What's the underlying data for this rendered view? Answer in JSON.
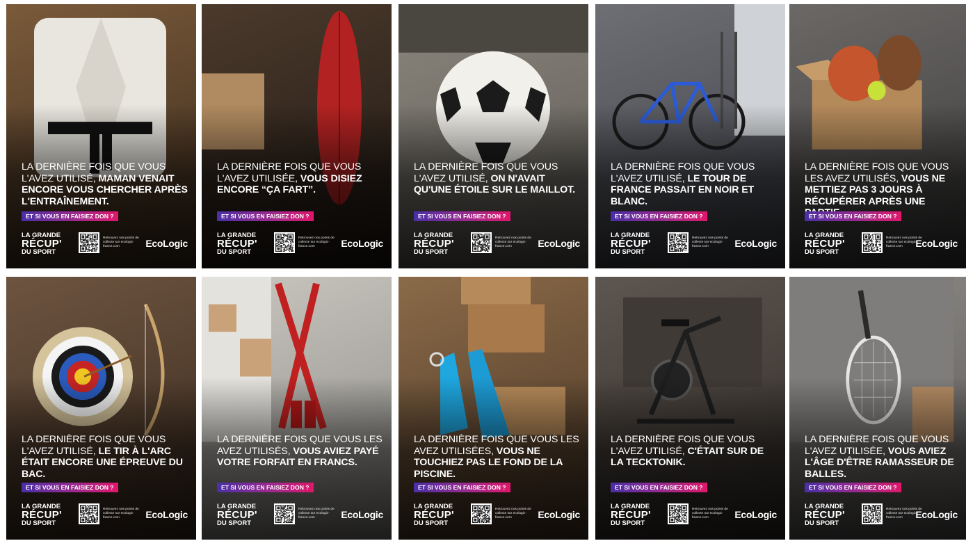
{
  "campaign": {
    "cta": "ET SI VOUS EN FAISIEZ DON ?",
    "brand_line1": "LA GRANDE",
    "brand_line2": "RÉCUP'",
    "brand_line3": "DU SPORT",
    "qr_text": "Retrouvez nos points de collecte sur ecologic-france.com",
    "logo": "EcoLogic",
    "cta_gradient": [
      "#4a2fa6",
      "#9b2a8e",
      "#e0176b"
    ]
  },
  "posters": [
    {
      "subject": "judo-gi-icon",
      "light": "LA DERNIÈRE FOIS QUE VOUS L'AVEZ UTILISÉ, ",
      "bold": "MAMAN VENAIT ENCORE VOUS CHERCHER APRÈS L'ENTRAÎNEMENT.",
      "bg": [
        "#3a2a1c",
        "#7a5a3a"
      ]
    },
    {
      "subject": "surfboard-icon",
      "light": "LA DERNIÈRE FOIS QUE VOUS L'AVEZ UTILISÉE, ",
      "bold": "VOUS DISIEZ ENCORE “ÇA FART”.",
      "bg": [
        "#1f1712",
        "#4b3a2c"
      ]
    },
    {
      "subject": "soccer-ball-icon",
      "light": "LA DERNIÈRE FOIS QUE VOUS L'AVEZ UTILISÉ, ",
      "bold": "ON N'AVAIT QU'UNE ÉTOILE SUR LE MAILLOT.",
      "bg": [
        "#5d5a55",
        "#8a857c"
      ]
    },
    {
      "subject": "bicycle-icon",
      "light": "LA DERNIÈRE FOIS QUE VOUS L'AVEZ UTILISÉ, ",
      "bold": "LE TOUR DE FRANCE PASSAIT EN NOIR ET BLANC.",
      "bg": [
        "#3d3f47",
        "#6e6f74"
      ]
    },
    {
      "subject": "balls-box-icon",
      "light": "LA DERNIÈRE FOIS QUE VOUS LES AVEZ UTILISÉS, ",
      "bold": "VOUS NE METTIEZ PAS 3 JOURS À RÉCUPÉRER APRÈS UNE PARTIE.",
      "bg": [
        "#3c3b3a",
        "#6b6866"
      ]
    },
    {
      "subject": "archery-target-icon",
      "light": "LA DERNIÈRE FOIS QUE VOUS L'AVEZ UTILISÉ, ",
      "bold": "LE TIR À L'ARC ÉTAIT ENCORE UNE ÉPREUVE DU BAC.",
      "bg": [
        "#3a2a1e",
        "#6d5440"
      ]
    },
    {
      "subject": "skis-icon",
      "light": "LA DERNIÈRE FOIS QUE VOUS LES AVEZ UTILISÉS, ",
      "bold": "VOUS AVIEZ PAYÉ VOTRE FORFAIT EN FRANCS.",
      "bg": [
        "#8e8c88",
        "#c9c6bf"
      ]
    },
    {
      "subject": "swim-fins-icon",
      "light": "LA DERNIÈRE FOIS QUE VOUS LES AVEZ UTILISÉES, ",
      "bold": "VOUS NE TOUCHIEZ PAS LE FOND DE LA PISCINE.",
      "bg": [
        "#4a3626",
        "#8a6a48"
      ]
    },
    {
      "subject": "exercise-bike-icon",
      "light": "LA DERNIÈRE FOIS QUE VOUS L'AVEZ UTILISÉ, ",
      "bold": "C'ÉTAIT SUR DE LA TECKTONIK.",
      "bg": [
        "#2f2a26",
        "#5e5650"
      ]
    },
    {
      "subject": "tennis-racket-icon",
      "light": "LA DERNIÈRE FOIS QUE VOUS L'AVEZ UTILISÉE, ",
      "bold": "VOUS AVIEZ L'ÂGE D'ÊTRE RAMASSEUR DE BALLES.",
      "bg": [
        "#5b5856",
        "#8d8a86"
      ]
    }
  ]
}
